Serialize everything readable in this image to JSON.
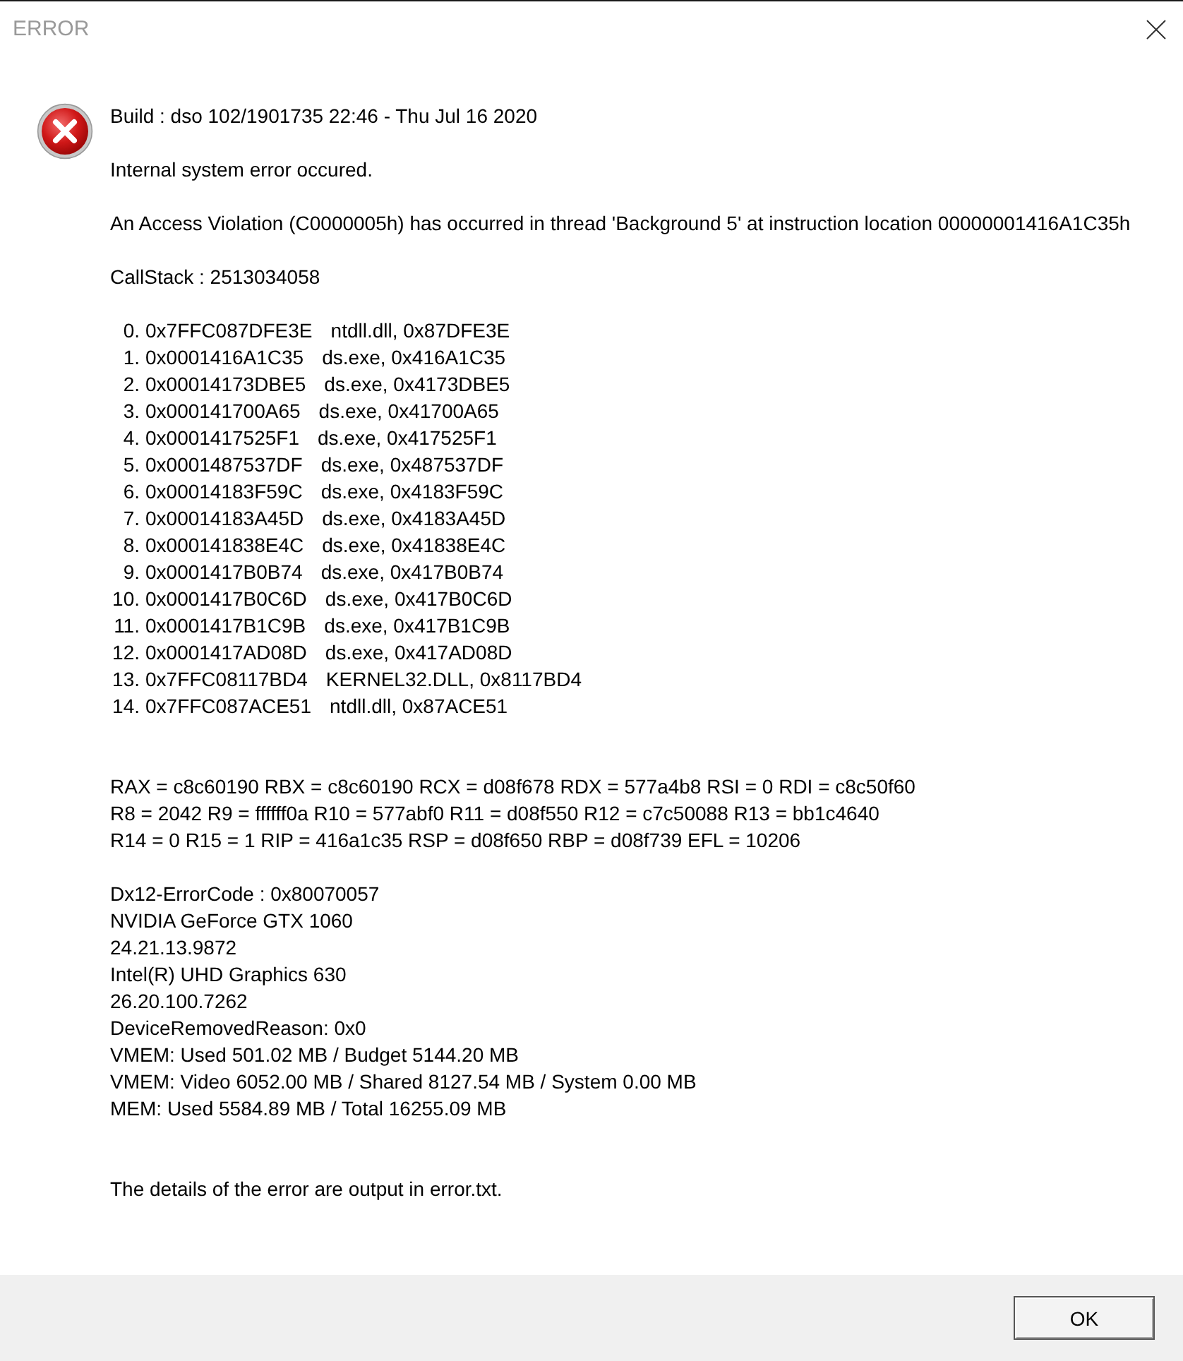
{
  "window": {
    "title": "ERROR"
  },
  "message": {
    "build": "Build : dso 102/1901735 22:46 - Thu Jul 16 2020",
    "summary": "Internal system error occured.",
    "violation": "An Access Violation (C0000005h) has occurred in thread 'Background 5' at instruction location 00000001416A1C35h",
    "callstack_label": "CallStack : 2513034058",
    "callstack": [
      {
        "index": "0.",
        "address": "0x7FFC087DFE3E",
        "location": "ntdll.dll, 0x87DFE3E"
      },
      {
        "index": "1.",
        "address": "0x0001416A1C35",
        "location": "ds.exe, 0x416A1C35"
      },
      {
        "index": "2.",
        "address": "0x00014173DBE5",
        "location": "ds.exe, 0x4173DBE5"
      },
      {
        "index": "3.",
        "address": "0x000141700A65",
        "location": "ds.exe, 0x41700A65"
      },
      {
        "index": "4.",
        "address": "0x0001417525F1",
        "location": "ds.exe, 0x417525F1"
      },
      {
        "index": "5.",
        "address": "0x0001487537DF",
        "location": "ds.exe, 0x487537DF"
      },
      {
        "index": "6.",
        "address": "0x00014183F59C",
        "location": "ds.exe, 0x4183F59C"
      },
      {
        "index": "7.",
        "address": "0x00014183A45D",
        "location": "ds.exe, 0x4183A45D"
      },
      {
        "index": "8.",
        "address": "0x000141838E4C",
        "location": "ds.exe, 0x41838E4C"
      },
      {
        "index": "9.",
        "address": "0x0001417B0B74",
        "location": "ds.exe, 0x417B0B74"
      },
      {
        "index": "10.",
        "address": "0x0001417B0C6D",
        "location": "ds.exe, 0x417B0C6D"
      },
      {
        "index": "11.",
        "address": "0x0001417B1C9B",
        "location": "ds.exe, 0x417B1C9B"
      },
      {
        "index": "12.",
        "address": "0x0001417AD08D",
        "location": "ds.exe, 0x417AD08D"
      },
      {
        "index": "13.",
        "address": "0x7FFC08117BD4",
        "location": "KERNEL32.DLL, 0x8117BD4"
      },
      {
        "index": "14.",
        "address": "0x7FFC087ACE51",
        "location": "ntdll.dll, 0x87ACE51"
      }
    ],
    "registers": [
      "RAX = c8c60190 RBX = c8c60190 RCX = d08f678 RDX = 577a4b8 RSI = 0 RDI = c8c50f60",
      "R8 = 2042 R9 = ffffff0a R10 = 577abf0 R11 = d08f550 R12 = c7c50088 R13 = bb1c4640",
      "R14 = 0 R15 = 1 RIP = 416a1c35 RSP = d08f650 RBP = d08f739 EFL = 10206"
    ],
    "device_info": [
      "Dx12-ErrorCode : 0x80070057",
      "NVIDIA GeForce GTX 1060",
      "24.21.13.9872",
      "Intel(R) UHD Graphics 630",
      "26.20.100.7262",
      "DeviceRemovedReason: 0x0",
      "VMEM: Used 501.02 MB / Budget 5144.20 MB",
      "VMEM: Video 6052.00 MB / Shared 8127.54 MB / System 0.00 MB",
      "MEM: Used 5584.89 MB / Total 16255.09 MB"
    ],
    "details_note": "The details of the error are output in error.txt."
  },
  "buttons": [
    {
      "label": "OK"
    }
  ]
}
